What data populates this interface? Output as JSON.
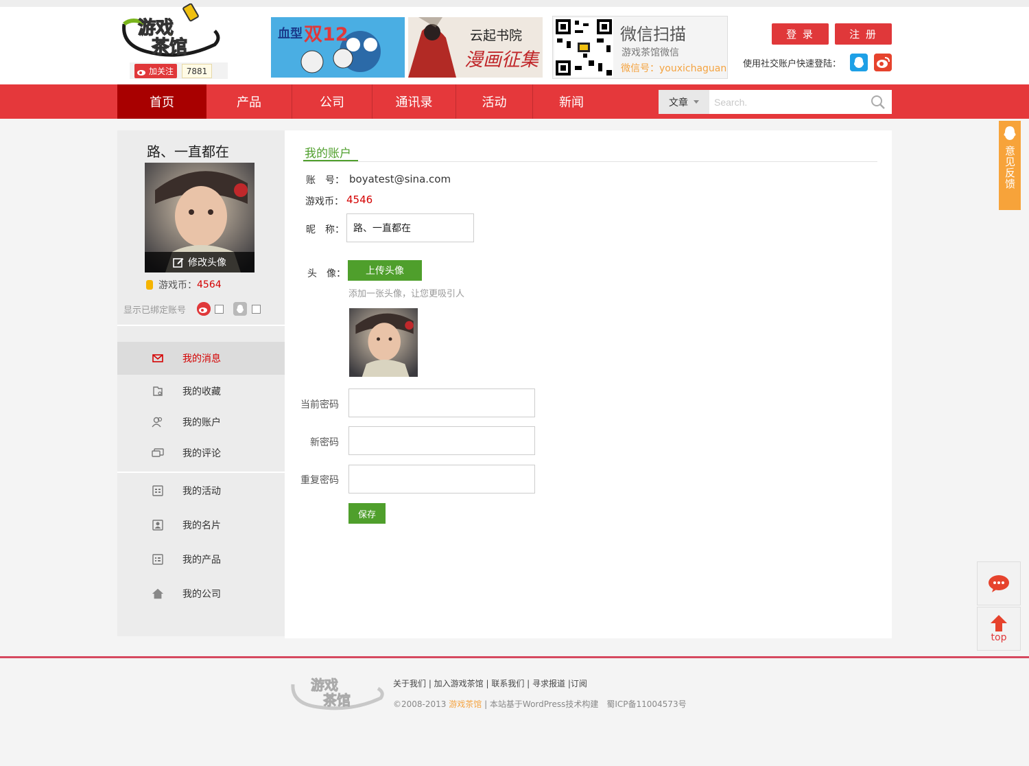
{
  "header": {
    "follow_label": "加关注",
    "follow_count": "7881",
    "ad1_text": "双12",
    "ad1_prefix": "血型",
    "ad2_title": "云起书院",
    "ad2_sub": "漫画征集",
    "wechat_title": "微信扫描",
    "wechat_sub": "游戏茶馆微信",
    "wechat_id": "微信号：youxichaguan",
    "login": "登 录",
    "register": "注 册",
    "social_label": "使用社交账户快速登陆："
  },
  "nav": {
    "items": [
      "首页",
      "产品",
      "公司",
      "通讯录",
      "活动",
      "新闻"
    ],
    "search_category": "文章",
    "search_placeholder": "Search."
  },
  "sidebar": {
    "username": "路、一直都在",
    "edit_avatar": "修改头像",
    "coin_label": "游戏币：",
    "coin_value": "4564",
    "bind_label": "显示已绑定账号",
    "menu": [
      "我的消息",
      "我的收藏",
      "我的账户",
      "我的评论",
      "我的活动",
      "我的名片",
      "我的产品",
      "我的公司"
    ]
  },
  "account": {
    "title": "我的账户",
    "account_label": "账　号：",
    "account_value": "boyatest@sina.com",
    "coin_label": "游戏币：",
    "coin_value": "4546",
    "nickname_label": "昵　称：",
    "nickname_value": "路、一直都在",
    "avatar_label": "头　像：",
    "upload_button": "上传头像",
    "upload_hint": "添加一张头像，让您更吸引人",
    "current_pw_label": "当前密码",
    "new_pw_label": "新密码",
    "repeat_pw_label": "重复密码",
    "save_button": "保存"
  },
  "floating": {
    "feedback": "意见反馈",
    "top": "top"
  },
  "footer": {
    "links": "关于我们 | 加入游戏茶馆 | 联系我们 | 寻求报道 |订阅",
    "copy_prefix": "©2008-2013 ",
    "copy_brand": "游戏茶馆",
    "copy_suffix": " | 本站基于WordPress技术构建　蜀ICP备11004573号"
  },
  "colors": {
    "brand_red": "#e5383b",
    "nav_active": "#a80000",
    "green": "#4f9f2c",
    "orange": "#f7a33a"
  }
}
